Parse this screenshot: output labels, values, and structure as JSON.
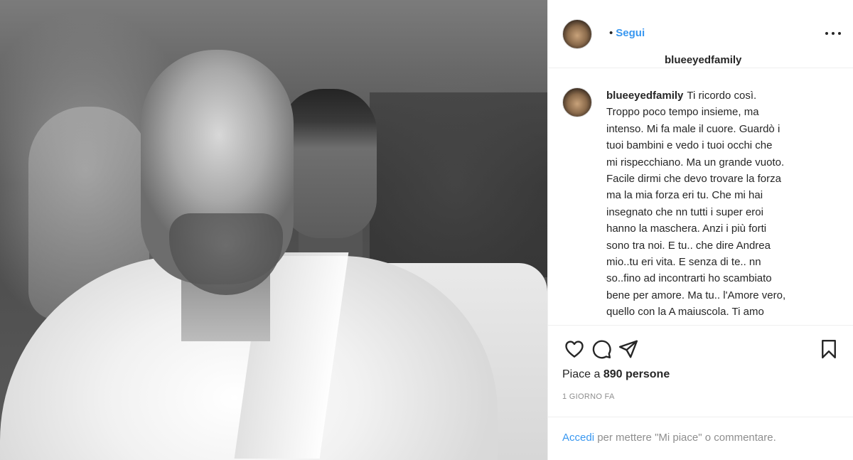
{
  "post": {
    "username": "blueeyedfamily",
    "follow_separator": "•",
    "follow_label": "Segui",
    "caption_lines": [
      "Ti ricordo così.",
      "Troppo poco tempo insieme, ma",
      "intenso. Mi fa male il cuore. Guardò i",
      "tuoi bambini e vedo i tuoi occhi che",
      "mi rispecchiano. Ma un grande vuoto.",
      "Facile dirmi che devo trovare la forza",
      "ma la mia forza eri tu. Che mi hai",
      "insegnato che nn tutti i super eroi",
      "hanno la maschera. Anzi i più forti",
      "sono tra noi. E tu.. che dire Andrea",
      "mio..tu eri vita. E senza di te.. nn",
      "so..fino ad incontrarti ho scambiato",
      "bene per amore. Ma tu.. l'Amore vero,",
      "quello con la A maiuscola. Ti amo"
    ],
    "likes_prefix": "Piace a",
    "likes_count": "890",
    "likes_suffix": "persone",
    "timestamp": "1 GIORNO FA"
  },
  "icons": {
    "like": "heart-icon",
    "comment": "comment-icon",
    "share": "paper-plane-icon",
    "save": "bookmark-icon",
    "more": "more-options-icon"
  },
  "login_bar": {
    "login_label": "Accedi",
    "text": " per mettere \"Mi piace\" o commentare."
  },
  "colors": {
    "link": "#3897f0",
    "text": "#262626",
    "muted": "#8e8e8e",
    "border": "#efefef"
  }
}
